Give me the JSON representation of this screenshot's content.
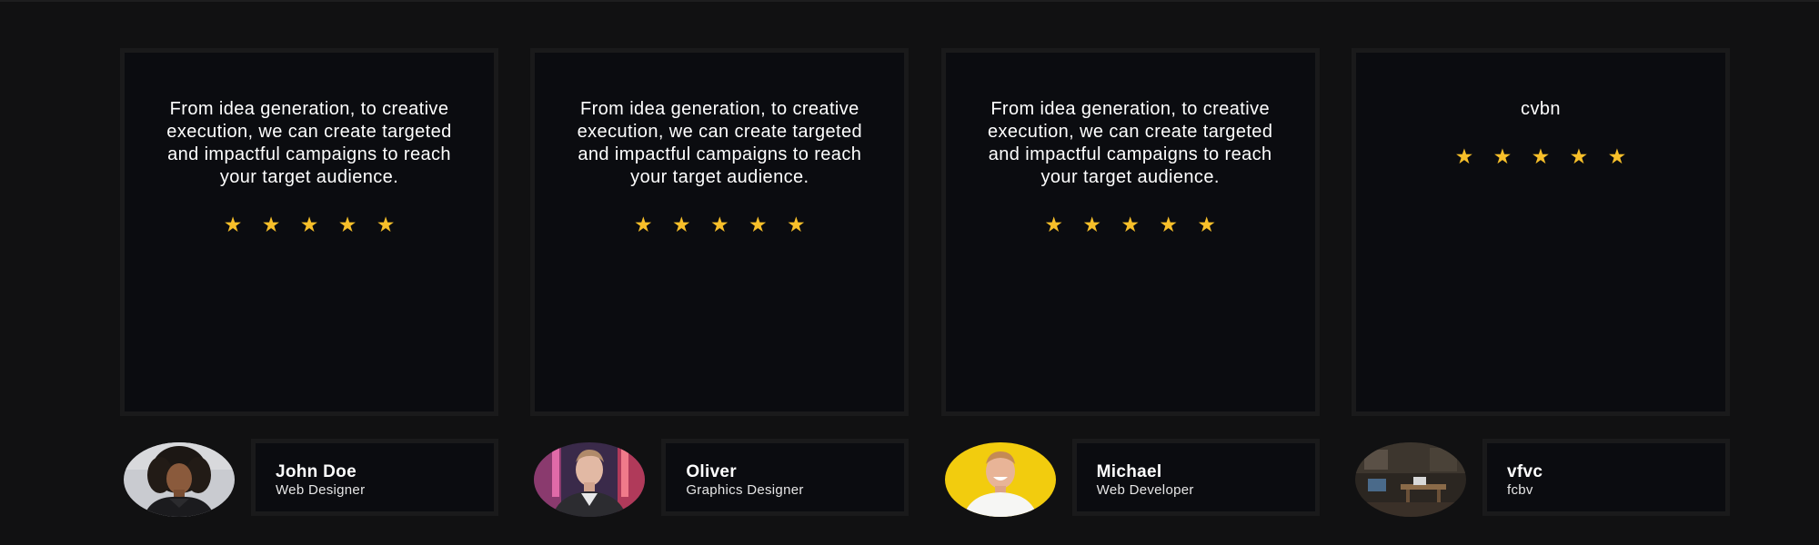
{
  "testimonials": [
    {
      "quote": "From idea generation, to creative execution, we can create targeted and impactful campaigns to reach your target audience.",
      "rating": 5,
      "author": {
        "name": "John Doe",
        "role": "Web Designer",
        "avatar": "woman-curly-hair-portrait"
      }
    },
    {
      "quote": "From idea generation, to creative execution, we can create targeted and impactful campaigns to reach your target audience.",
      "rating": 5,
      "author": {
        "name": "Oliver",
        "role": "Graphics Designer",
        "avatar": "man-neon-background-portrait"
      }
    },
    {
      "quote": "From idea generation, to creative execution, we can create targeted and impactful campaigns to reach your target audience.",
      "rating": 5,
      "author": {
        "name": "Michael",
        "role": "Web Developer",
        "avatar": "man-smiling-yellow-background"
      }
    },
    {
      "quote": "cvbn",
      "rating": 5,
      "author": {
        "name": "vfvc",
        "role": "fcbv",
        "avatar": "office-interior-photo"
      }
    }
  ],
  "colors": {
    "page_background": "#111112",
    "card_background": "#0b0c10",
    "card_border": "#1a1a1b",
    "star": "#f7bf2a",
    "text": "#ffffff"
  }
}
